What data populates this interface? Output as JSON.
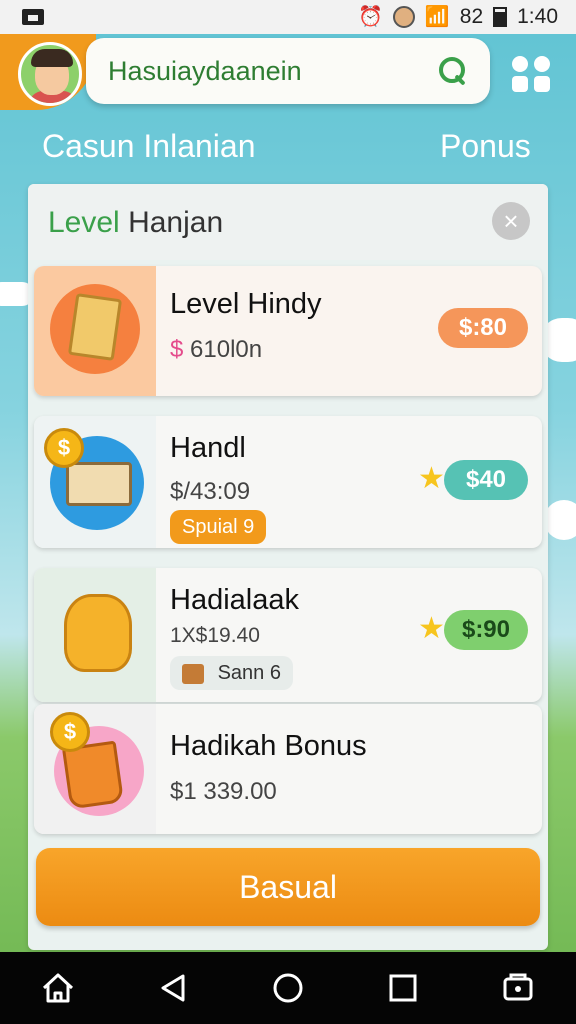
{
  "status_bar": {
    "battery_text": "82",
    "time": "1:40"
  },
  "header": {
    "search_text": "Hasuiaydaanein",
    "icons": [
      "avatar",
      "search-icon",
      "grid-icon"
    ]
  },
  "tabs": {
    "left": "Casun Inlanian",
    "right": "Ponus"
  },
  "panel": {
    "title_accent": "Level",
    "title_rest": "Hanjan",
    "close_label": "×",
    "items": [
      {
        "title": "Level Hindy",
        "price_symbol": "$",
        "price": "610l0n",
        "pill": "$:80",
        "pill_color": "#f5965a"
      },
      {
        "title": "Handl",
        "price": "$/43:09",
        "pill": "$40",
        "pill_color": "#56c2b4",
        "badge": "Spuial  9"
      },
      {
        "title": "Hadialaak",
        "price": "1X$19.40",
        "pill": "$:90",
        "pill_color": "#7fcf6e",
        "badge": "Sann  6"
      },
      {
        "title": "Hadikah Bonus",
        "price": "$1 339.00"
      }
    ]
  },
  "cta": {
    "label": "Basual"
  },
  "colors": {
    "accent_orange": "#f19a1d",
    "accent_green": "#3aa04a",
    "sky": "#5fc3d3"
  }
}
